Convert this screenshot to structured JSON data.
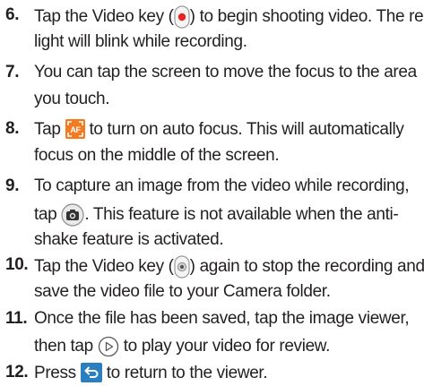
{
  "steps": [
    {
      "num": "6.",
      "line1_a": "Tap the Video key (",
      "line1_b": ") to begin shooting video. The red",
      "line2": "light will blink while recording.",
      "icon": "video-record-key-icon"
    },
    {
      "num": "7.",
      "line1": "You can tap the screen to move the focus to the area",
      "line2": "you touch."
    },
    {
      "num": "8.",
      "line1_a": "Tap",
      "line1_b": "to turn on auto focus. This will automatically",
      "line2": "focus on the middle of the screen.",
      "icon": "auto-focus-af-icon"
    },
    {
      "num": "9.",
      "line1": "To capture an image from the video while recording,",
      "line2_a": "tap",
      "line2_b": ". This feature is not available when the anti-",
      "line3": "shake feature is activated.",
      "icon": "camera-capture-icon"
    },
    {
      "num": "10.",
      "line1_a": "Tap the Video key (",
      "line1_b": ") again to stop the recording and",
      "line2": "save the video file to your Camera folder.",
      "icon": "video-stop-key-icon"
    },
    {
      "num": "11.",
      "line1": "Once the file has been saved, tap the image viewer,",
      "line2_a": "then tap",
      "line2_b": "to play your video for review.",
      "icon": "play-icon"
    },
    {
      "num": "12.",
      "line1_a": "Press",
      "line1_b": "to return to the viewer.",
      "icon": "back-icon"
    }
  ],
  "colors": {
    "text": "#231f20",
    "record_red": "#e8251f",
    "af_orange": "#f47a20",
    "back_blue": "#2a7fc1"
  }
}
